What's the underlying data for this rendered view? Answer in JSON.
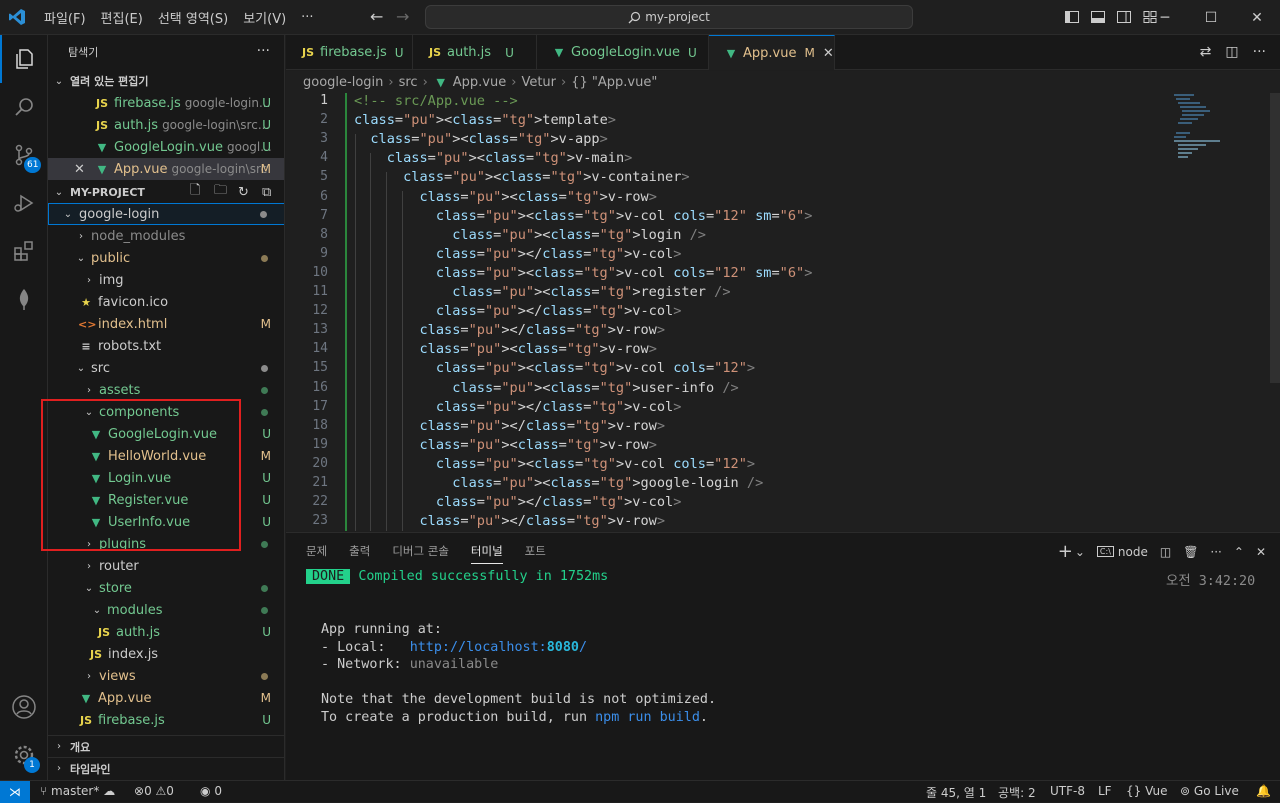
{
  "titlebar": {
    "menus": [
      "파일(F)",
      "편집(E)",
      "선택 영역(S)",
      "보기(V)",
      "···"
    ],
    "search_text": "my-project"
  },
  "activity": {
    "scm_badge": "61",
    "accounts_badge": "1"
  },
  "sidebar": {
    "title": "탐색기",
    "open_editors_header": "열려 있는 편집기",
    "open_editors": [
      {
        "name": "firebase.js",
        "desc": "google-login...",
        "status": "U"
      },
      {
        "name": "auth.js",
        "desc": "google-login\\src...",
        "status": "U"
      },
      {
        "name": "GoogleLogin.vue",
        "desc": "googl...",
        "status": "U"
      },
      {
        "name": "App.vue",
        "desc": "google-login\\src",
        "status": "M"
      }
    ],
    "project_header": "MY-PROJECT",
    "tree": [
      {
        "name": "google-login",
        "status": ""
      },
      {
        "name": "node_modules",
        "status": ""
      },
      {
        "name": "public",
        "status": ""
      },
      {
        "name": "img",
        "status": ""
      },
      {
        "name": "favicon.ico",
        "status": ""
      },
      {
        "name": "index.html",
        "status": "M"
      },
      {
        "name": "robots.txt",
        "status": ""
      },
      {
        "name": "src",
        "status": ""
      },
      {
        "name": "assets",
        "status": ""
      },
      {
        "name": "components",
        "status": ""
      },
      {
        "name": "GoogleLogin.vue",
        "status": "U"
      },
      {
        "name": "HelloWorld.vue",
        "status": "M"
      },
      {
        "name": "Login.vue",
        "status": "U"
      },
      {
        "name": "Register.vue",
        "status": "U"
      },
      {
        "name": "UserInfo.vue",
        "status": "U"
      },
      {
        "name": "plugins",
        "status": ""
      },
      {
        "name": "router",
        "status": ""
      },
      {
        "name": "store",
        "status": ""
      },
      {
        "name": "modules",
        "status": ""
      },
      {
        "name": "auth.js",
        "status": "U"
      },
      {
        "name": "index.js",
        "status": ""
      },
      {
        "name": "views",
        "status": ""
      },
      {
        "name": "App.vue",
        "status": "M"
      },
      {
        "name": "firebase.js",
        "status": "U"
      }
    ],
    "outline_header": "개요",
    "timeline_header": "타임라인"
  },
  "tabs": [
    {
      "name": "firebase.js",
      "status": "U"
    },
    {
      "name": "auth.js",
      "status": "U"
    },
    {
      "name": "GoogleLogin.vue",
      "status": "U"
    },
    {
      "name": "App.vue",
      "status": "M"
    }
  ],
  "breadcrumb": [
    "google-login",
    "src",
    "App.vue",
    "Vetur",
    "{} \"App.vue\""
  ],
  "code": {
    "line_numbers": [
      "1",
      "2",
      "3",
      "4",
      "5",
      "6",
      "7",
      "8",
      "9",
      "10",
      "11",
      "12",
      "13",
      "14",
      "15",
      "16",
      "17",
      "18",
      "19",
      "20",
      "21",
      "22",
      "23"
    ],
    "lines": [
      "<!-- src/App.vue -->",
      "<template>",
      "  <v-app>",
      "    <v-main>",
      "      <v-container>",
      "        <v-row>",
      "          <v-col cols=\"12\" sm=\"6\">",
      "            <login />",
      "          </v-col>",
      "          <v-col cols=\"12\" sm=\"6\">",
      "            <register />",
      "          </v-col>",
      "        </v-row>",
      "        <v-row>",
      "          <v-col cols=\"12\">",
      "            <user-info />",
      "          </v-col>",
      "        </v-row>",
      "        <v-row>",
      "          <v-col cols=\"12\">",
      "            <google-login />",
      "          </v-col>",
      "        </v-row>"
    ]
  },
  "panel": {
    "tabs": [
      "문제",
      "출력",
      "디버그 콘솔",
      "터미널",
      "포트"
    ],
    "active_tab": "터미널",
    "shell": "node",
    "terminal": {
      "done_badge": "DONE",
      "compiled": "Compiled successfully in 1752ms",
      "time": "오전 3:42:20",
      "running": "App running at:",
      "local_label": "- Local:   ",
      "local_url": "http://localhost:",
      "local_port": "8080",
      "local_slash": "/",
      "network_label": "- Network: ",
      "network_value": "unavailable",
      "note1": "Note that the development build is not optimized.",
      "note2_pre": "To create a production build, run ",
      "note2_cmd": "npm run build",
      "note2_post": "."
    }
  },
  "statusbar": {
    "branch": "master*",
    "errors": "0",
    "warnings": "0",
    "ports": "0",
    "position": "줄 45, 열 1",
    "spaces": "공백: 2",
    "encoding": "UTF-8",
    "eol": "LF",
    "language": "Vue",
    "golive": "Go Live"
  }
}
